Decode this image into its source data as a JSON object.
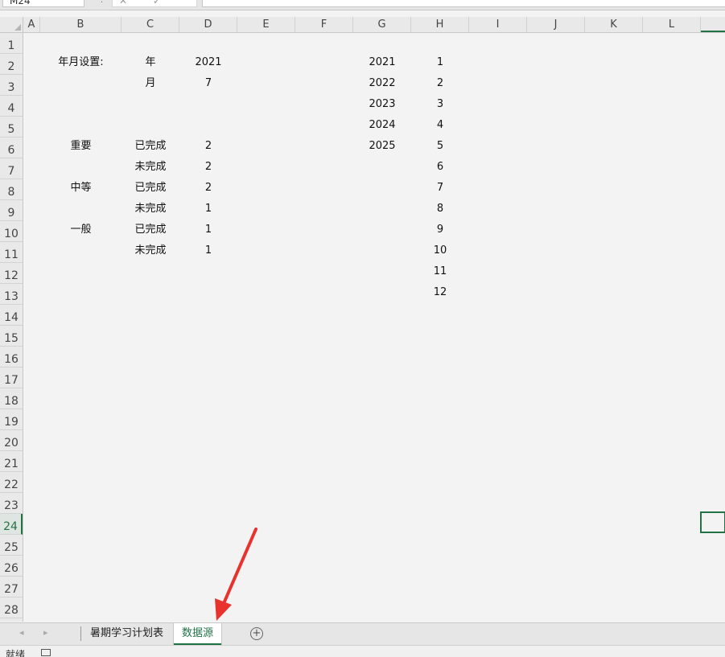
{
  "formula_bar": {
    "name_box": "M24",
    "separator": "⋮",
    "buttons": "✕ ✓ fx"
  },
  "columns": [
    "A",
    "B",
    "C",
    "D",
    "E",
    "F",
    "G",
    "H",
    "I",
    "J",
    "K",
    "L"
  ],
  "rows": [
    "1",
    "2",
    "3",
    "4",
    "5",
    "6",
    "7",
    "8",
    "9",
    "10",
    "11",
    "12",
    "13",
    "14",
    "15",
    "16",
    "17",
    "18",
    "19",
    "20",
    "21",
    "22",
    "23",
    "24",
    "25",
    "26",
    "27",
    "28"
  ],
  "cells": {
    "B2": "年月设置:",
    "C2": "年",
    "D2": "2021",
    "C3": "月",
    "D3": "7",
    "B6": "重要",
    "C6": "已完成",
    "D6": "2",
    "C7": "未完成",
    "D7": "2",
    "B8": "中等",
    "C8": "已完成",
    "D8": "2",
    "C9": "未完成",
    "D9": "1",
    "B10": "一般",
    "C10": "已完成",
    "D10": "1",
    "C11": "未完成",
    "D11": "1",
    "G2": "2021",
    "G3": "2022",
    "G4": "2023",
    "G5": "2024",
    "G6": "2025",
    "H2": "1",
    "H3": "2",
    "H4": "3",
    "H5": "4",
    "H6": "5",
    "H7": "6",
    "H8": "7",
    "H9": "8",
    "H10": "9",
    "H11": "10",
    "H12": "11",
    "H13": "12"
  },
  "sheet_tabs": {
    "prev": "◂",
    "next": "▸",
    "tabs": [
      "暑期学习计划表",
      "数据源"
    ],
    "active_index": 1,
    "add": "+"
  },
  "status": {
    "text": "就绪"
  },
  "colors": {
    "accent": "#217346",
    "annotation": "#e8322e"
  },
  "icons": [
    "corner-select-all-icon",
    "add-sheet-icon",
    "macro-record-icon",
    "annotation-arrow-icon"
  ]
}
